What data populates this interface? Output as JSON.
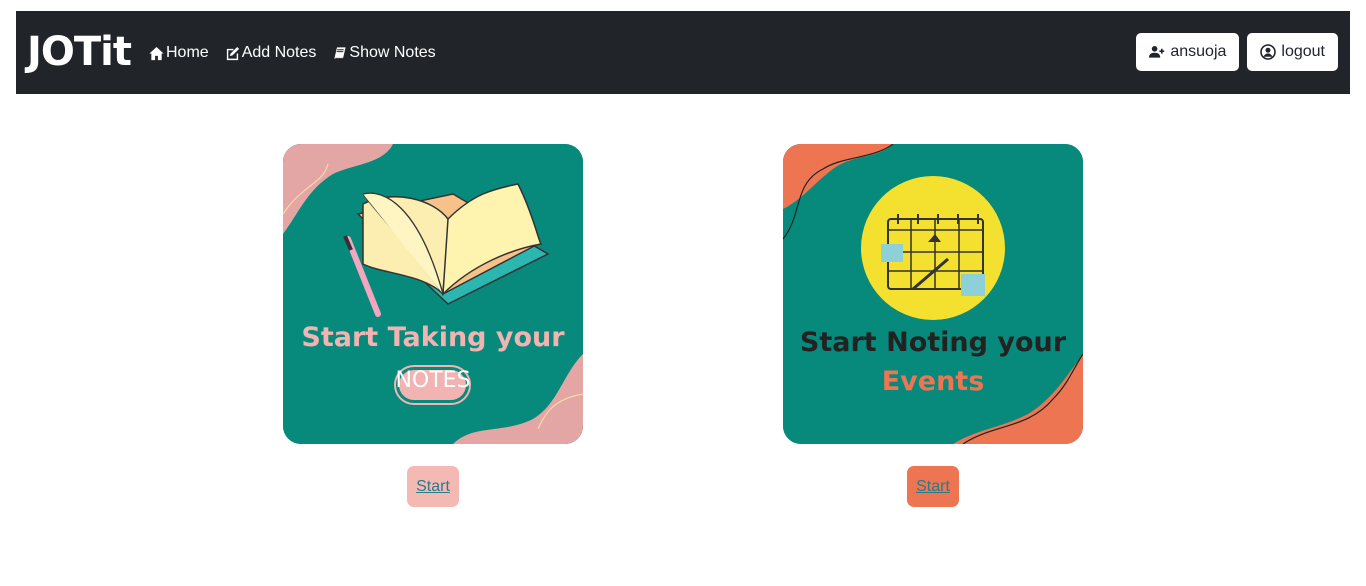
{
  "navbar": {
    "brand": "JOTit",
    "links": [
      {
        "label": "Home",
        "icon": "home-icon"
      },
      {
        "label": "Add Notes",
        "icon": "edit-icon"
      },
      {
        "label": "Show Notes",
        "icon": "book-icon"
      }
    ],
    "user_button": {
      "label": "ansuoja",
      "icon": "user-plus-icon"
    },
    "logout_button": {
      "label": "logout",
      "icon": "user-circle-icon"
    }
  },
  "cards": [
    {
      "title_line1": "Start Taking your",
      "title_line2": "NOTES",
      "button_label": "Start",
      "colors": {
        "bg": "#078a7b",
        "accent": "#e4a6a4",
        "text": "#f1b4b2"
      }
    },
    {
      "title_line1": "Start Noting your",
      "title_line2": "Events",
      "button_label": "Start",
      "colors": {
        "bg": "#078a7b",
        "accent": "#ee7552",
        "circle": "#f4e02e",
        "text": "#222222"
      }
    }
  ]
}
